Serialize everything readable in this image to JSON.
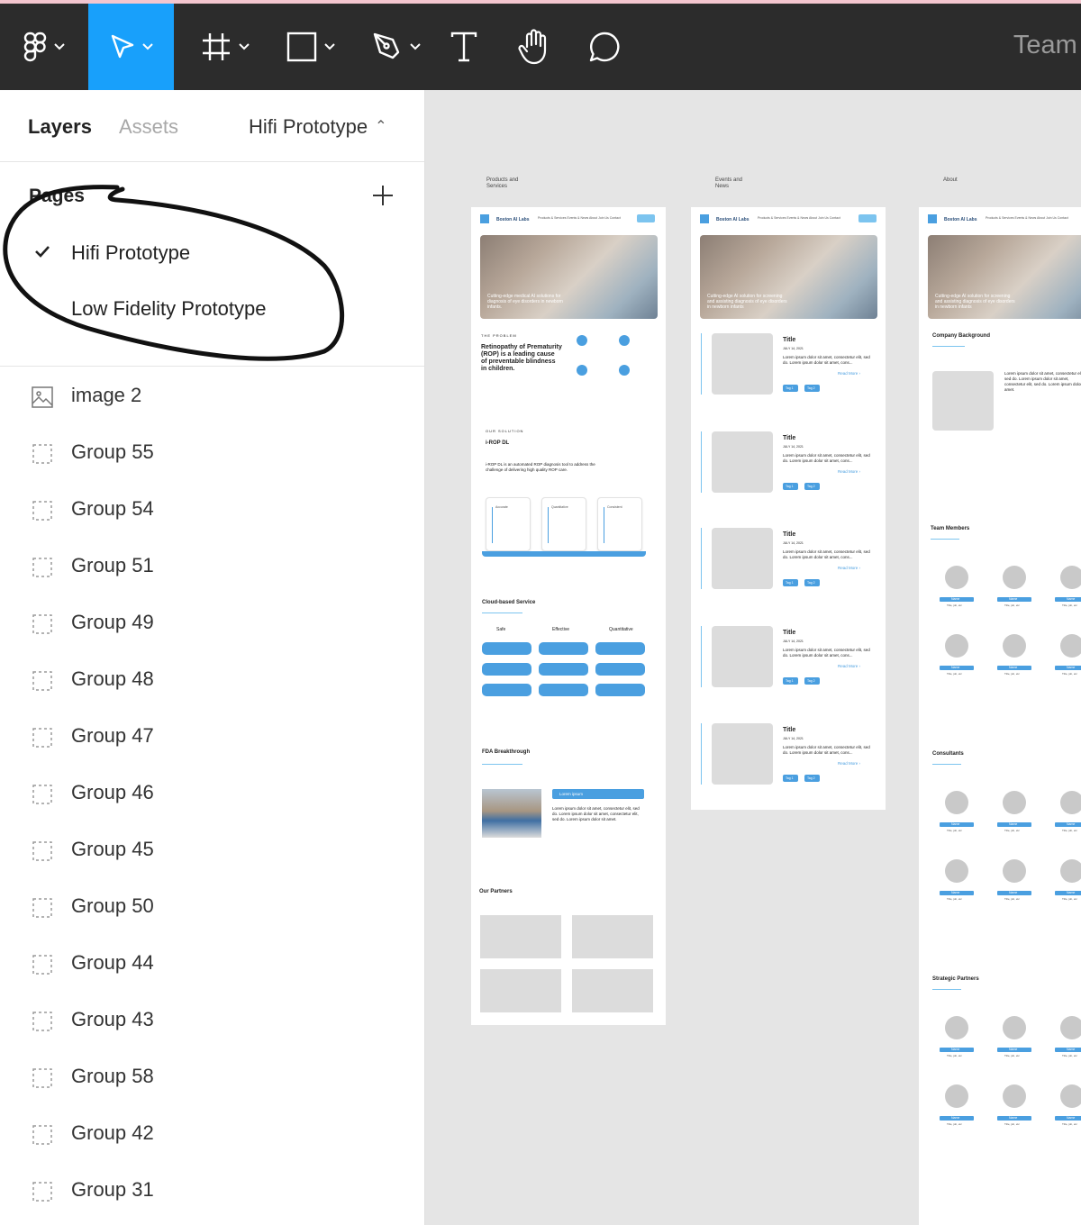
{
  "toolbar": {
    "team_title": "Team p",
    "tools": [
      {
        "name": "figma-menu",
        "icon": "figma-logo-icon"
      },
      {
        "name": "move-tool",
        "icon": "cursor-arrow-icon",
        "active": true
      },
      {
        "name": "frame-tool",
        "icon": "hash-frame-icon"
      },
      {
        "name": "shape-tool",
        "icon": "rectangle-icon"
      },
      {
        "name": "pen-tool",
        "icon": "pen-icon"
      },
      {
        "name": "text-tool",
        "icon": "text-T-icon"
      },
      {
        "name": "hand-tool",
        "icon": "hand-icon"
      },
      {
        "name": "comment-tool",
        "icon": "comment-bubble-icon"
      }
    ]
  },
  "panel": {
    "tab_layers": "Layers",
    "tab_assets": "Assets",
    "current_page": "Hifi Prototype",
    "pages_title": "Pages",
    "pages": [
      "Hifi Prototype",
      "Low Fidelity Prototype"
    ],
    "layers": [
      {
        "name": "image 2",
        "icon": "image-icon"
      },
      {
        "name": "Group 55",
        "icon": "group-icon"
      },
      {
        "name": "Group 54",
        "icon": "group-icon"
      },
      {
        "name": "Group 51",
        "icon": "group-icon"
      },
      {
        "name": "Group 49",
        "icon": "group-icon"
      },
      {
        "name": "Group 48",
        "icon": "group-icon"
      },
      {
        "name": "Group 47",
        "icon": "group-icon"
      },
      {
        "name": "Group 46",
        "icon": "group-icon"
      },
      {
        "name": "Group 45",
        "icon": "group-icon"
      },
      {
        "name": "Group 50",
        "icon": "group-icon"
      },
      {
        "name": "Group 44",
        "icon": "group-icon"
      },
      {
        "name": "Group 43",
        "icon": "group-icon"
      },
      {
        "name": "Group 58",
        "icon": "group-icon"
      },
      {
        "name": "Group 42",
        "icon": "group-icon"
      },
      {
        "name": "Group 31",
        "icon": "group-icon"
      }
    ]
  },
  "canvas": {
    "frame_labels": [
      "Products and Services",
      "Events and News",
      "About"
    ],
    "brand": "Boston AI Labs",
    "nav_links": "Products & Services   Events & News   About   Join Us   Contact",
    "hero_text_1": "Cutting-edge medical AI solutions for diagnosis of eye disorders in newborn infants.",
    "hero_text_2": "Cutting-edge AI solution for screening and assisting diagnosis of eye disorders in newborn infants",
    "products": {
      "problem_label": "THE PROBLEM",
      "problem_text": "Retinopathy of Prematurity (ROP) is a leading cause of preventable blindness in children.",
      "solution_label": "OUR SOLUTION",
      "solution_title": "i-ROP DL",
      "solution_text": "i-ROP DL is an automated ROP diagnosis tool to address the challenge of delivering high quality ROP care.",
      "cards": [
        "Accurate",
        "Quantitative",
        "Consistent"
      ],
      "cloud_title": "Cloud-based Service",
      "features": [
        "Safe",
        "Effective",
        "Quantitative"
      ],
      "fda_title": "FDA Breakthrough",
      "fda_pill": "Lorem ipsum",
      "fda_text": "Lorem ipsum dolor sit amet, consectetur elit, sed do. Lorem ipsum dolor sit amet, consectetur elit, sed do. Lorem ipsum dolor sit amet.",
      "partners_title": "Our Partners"
    },
    "events": {
      "item_title": "Title",
      "item_date": "JULY 14, 2021",
      "item_text": "Lorem ipsum dolor sit amet, consectetur elit, sed do. Lorem ipsum dolor sit amet, cons...",
      "read_more": "Read More ›",
      "tag1": "Tag 1",
      "tag2": "Tag 2"
    },
    "about": {
      "company_title": "Company Background",
      "company_text": "Lorem ipsum dolor sit amet, consectetur elit, sed do. Lorem ipsum dolor sit amet, consectetur elit, sed do. Lorem ipsum dolor sit amet.",
      "team_title": "Team Members",
      "consultants_title": "Consultants",
      "strategic_title": "Strategic Partners",
      "person_name": "Name",
      "person_role": "Title, job, etc"
    }
  },
  "colors": {
    "toolbar_bg": "#2c2c2c",
    "active_tool": "#18a0fb",
    "canvas_bg": "#e5e5e5",
    "accent": "#4a9fe0"
  }
}
